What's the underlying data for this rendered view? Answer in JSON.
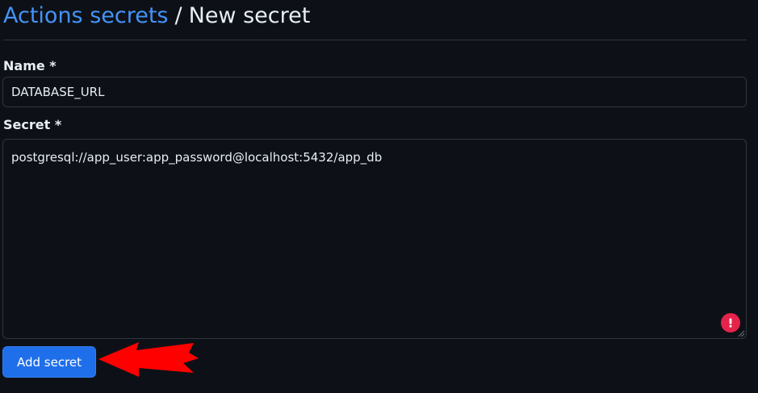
{
  "header": {
    "breadcrumb_link": "Actions secrets",
    "separator": "/",
    "current": "New secret"
  },
  "form": {
    "name_label": "Name *",
    "name_value": "DATABASE_URL",
    "secret_label": "Secret *",
    "secret_value": "postgresql://app_user:app_password@localhost:5432/app_db",
    "submit_label": "Add secret"
  },
  "icons": {
    "alert": "alert-icon",
    "annotation_arrow": "arrow-icon"
  },
  "colors": {
    "background": "#0d1117",
    "link": "#4493f8",
    "button": "#1f6feb",
    "alert": "#e5234b",
    "arrow": "#ff0000"
  }
}
